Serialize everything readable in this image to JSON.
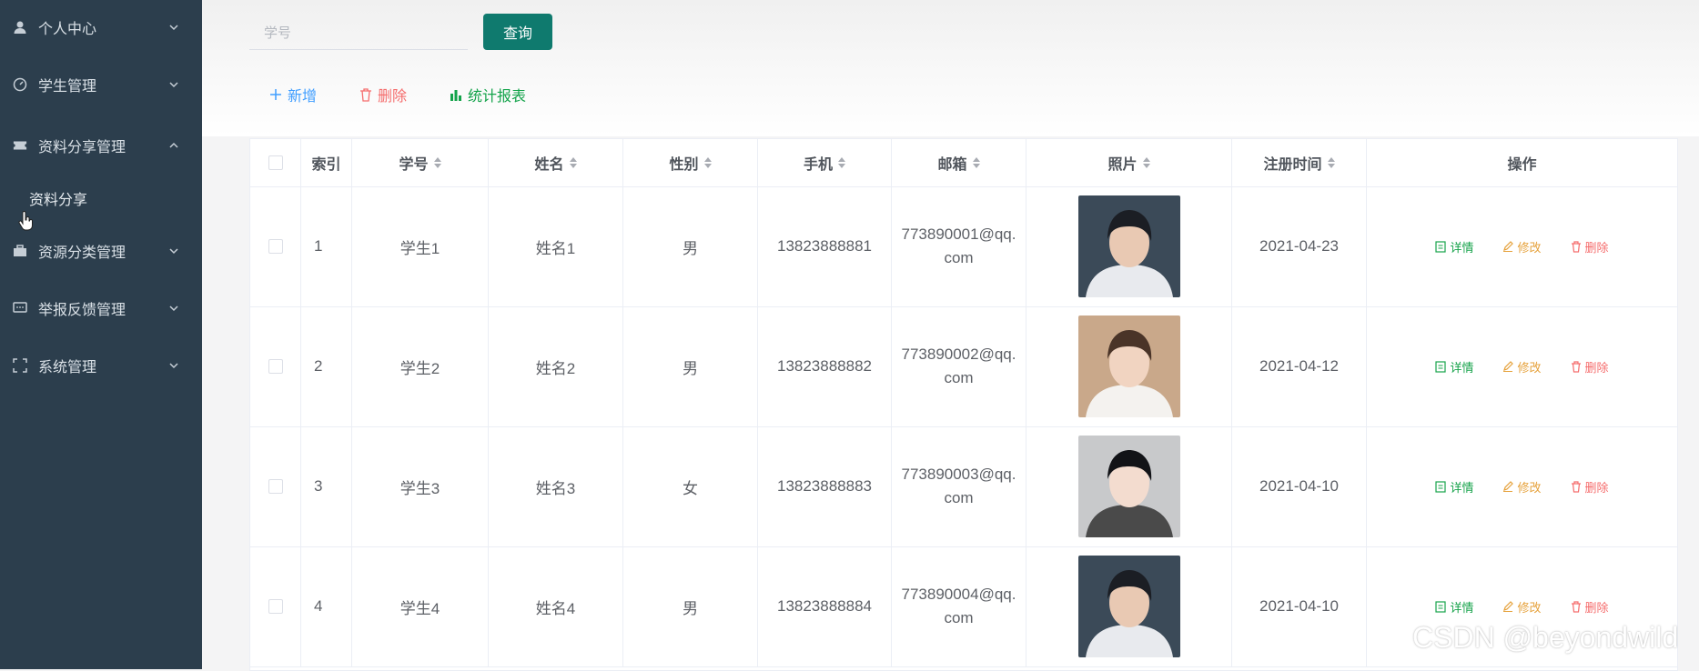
{
  "sidebar": {
    "items": [
      {
        "label": "个人中心",
        "icon": "user-icon"
      },
      {
        "label": "学生管理",
        "icon": "dashboard-icon"
      },
      {
        "label": "资料分享管理",
        "icon": "ticket-icon"
      },
      {
        "label": "资源分类管理",
        "icon": "briefcase-icon"
      },
      {
        "label": "举报反馈管理",
        "icon": "message-icon"
      },
      {
        "label": "系统管理",
        "icon": "frame-icon"
      }
    ],
    "sub_item": "资料分享"
  },
  "search": {
    "placeholder": "学号",
    "button": "查询"
  },
  "toolbar": {
    "add": "新增",
    "delete": "删除",
    "report": "统计报表"
  },
  "colors": {
    "sidebar": "#2c3e4d",
    "primary": "#0f7a6e",
    "add": "#409eff",
    "delete": "#f56c6c",
    "report": "#13a34a",
    "edit": "#e6a23c",
    "detail": "#16a34a"
  },
  "table": {
    "headers": {
      "index": "索引",
      "no": "学号",
      "name": "姓名",
      "gender": "性别",
      "phone": "手机",
      "email": "邮箱",
      "photo": "照片",
      "regtime": "注册时间",
      "ops": "操作"
    },
    "ops": {
      "detail": "详情",
      "edit": "修改",
      "delete": "删除"
    },
    "rows": [
      {
        "index": "1",
        "no": "学生1",
        "name": "姓名1",
        "gender": "男",
        "phone": "13823888881",
        "email": "773890001@qq.com",
        "regtime": "2021-04-23"
      },
      {
        "index": "2",
        "no": "学生2",
        "name": "姓名2",
        "gender": "男",
        "phone": "13823888882",
        "email": "773890002@qq.com",
        "regtime": "2021-04-12"
      },
      {
        "index": "3",
        "no": "学生3",
        "name": "姓名3",
        "gender": "女",
        "phone": "13823888883",
        "email": "773890003@qq.com",
        "regtime": "2021-04-10"
      },
      {
        "index": "4",
        "no": "学生4",
        "name": "姓名4",
        "gender": "男",
        "phone": "13823888884",
        "email": "773890004@qq.com",
        "regtime": "2021-04-10"
      }
    ]
  },
  "watermark": "CSDN @beyondwild"
}
